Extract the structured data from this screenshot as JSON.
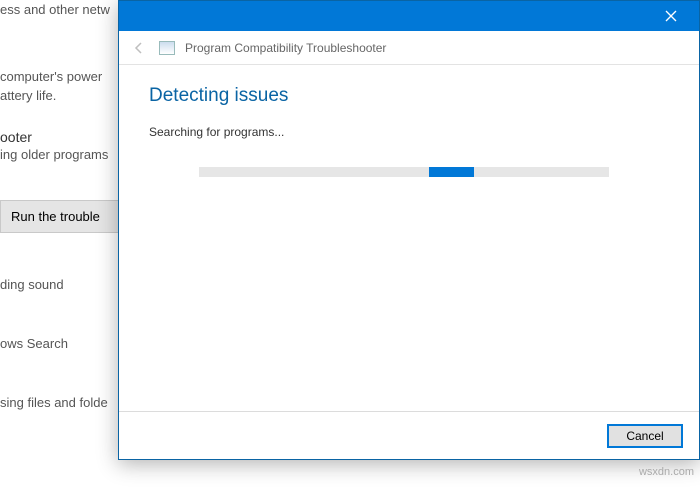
{
  "background": {
    "line1": "ess and other netw",
    "line2": "computer's power",
    "line3": "attery life.",
    "heading1": "ooter",
    "line4": "ing older programs",
    "run_button": "Run the trouble",
    "line5": "ding sound",
    "line6": "ows Search",
    "line7": "sing files and folde"
  },
  "dialog": {
    "header_title": "Program Compatibility Troubleshooter",
    "title": "Detecting issues",
    "subtitle": "Searching for programs...",
    "cancel": "Cancel"
  },
  "watermark": "wsxdn.com"
}
